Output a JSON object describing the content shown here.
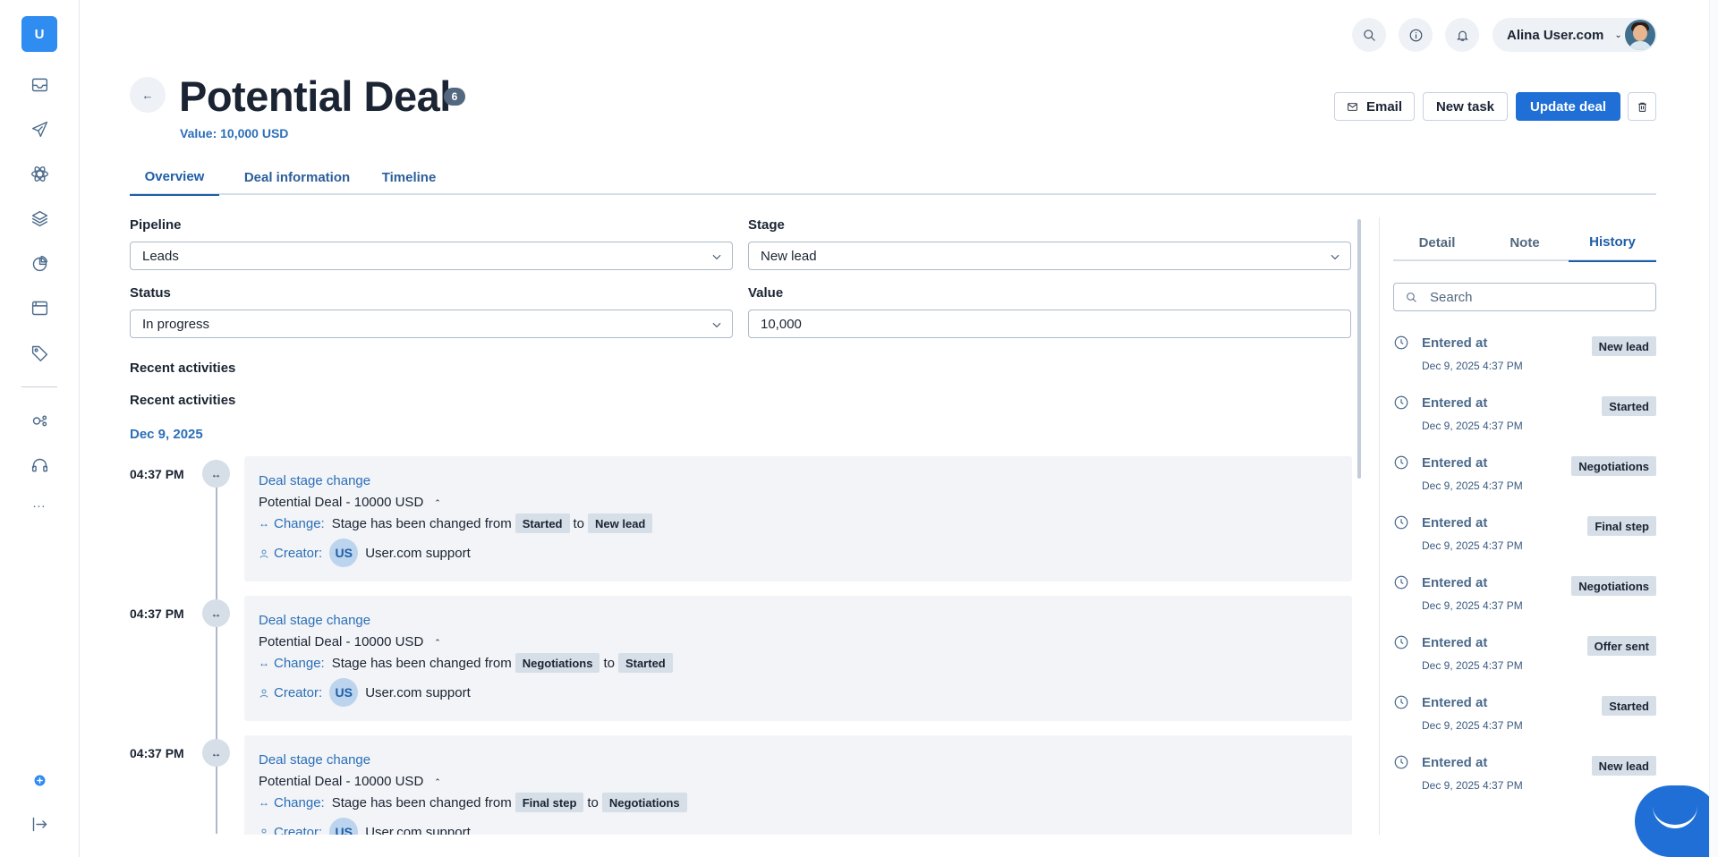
{
  "rail": {
    "logo": "U",
    "icons": [
      "inbox-icon",
      "send-icon",
      "atom-icon",
      "layers-icon",
      "segments-icon",
      "browser-icon",
      "tags-icon",
      "integration-icon",
      "support-icon"
    ],
    "more": "...",
    "bottom_icons": [
      "help-dot-icon",
      "logout-icon"
    ]
  },
  "topbar": {
    "user_name": "Alina User.com",
    "icons": [
      "search-icon",
      "info-icon",
      "bell-icon"
    ]
  },
  "header": {
    "back": "←",
    "title": "Potential Deal",
    "badge": "6",
    "value": "Value: 10,000 USD",
    "email_btn": "Email",
    "new_task_btn": "New task",
    "update_btn": "Update deal"
  },
  "tabs": [
    "Overview",
    "Deal information",
    "Timeline"
  ],
  "form": {
    "pipeline_label": "Pipeline",
    "pipeline_value": "Leads",
    "stage_label": "Stage",
    "stage_value": "New lead",
    "status_label": "Status",
    "status_value": "In progress",
    "value_label": "Value",
    "value_value": "10,000"
  },
  "activities": {
    "title1": "Recent activities",
    "title2": "Recent activities",
    "date": "Dec 9, 2025",
    "items": [
      {
        "time": "04:37 PM",
        "icon": "↔",
        "title": "Deal stage change",
        "deal": "Potential Deal - 10000 USD",
        "change_label": "Change:",
        "change_text": "Stage has been changed from",
        "from": "Started",
        "to_word": "to",
        "to": "New lead",
        "creator_label": "Creator:",
        "creator_initials": "US",
        "creator": "User.com support"
      },
      {
        "time": "04:37 PM",
        "icon": "↔",
        "title": "Deal stage change",
        "deal": "Potential Deal - 10000 USD",
        "change_label": "Change:",
        "change_text": "Stage has been changed from",
        "from": "Negotiations",
        "to_word": "to",
        "to": "Started",
        "creator_label": "Creator:",
        "creator_initials": "US",
        "creator": "User.com support"
      },
      {
        "time": "04:37 PM",
        "icon": "↔",
        "title": "Deal stage change",
        "deal": "Potential Deal - 10000 USD",
        "change_label": "Change:",
        "change_text": "Stage has been changed from",
        "from": "Final step",
        "to_word": "to",
        "to": "Negotiations",
        "creator_label": "Creator:",
        "creator_initials": "US",
        "creator": "User.com support"
      }
    ]
  },
  "side": {
    "tabs": [
      "Detail",
      "Note",
      "History"
    ],
    "active_tab": "History",
    "search_placeholder": "Search",
    "history": [
      {
        "label": "Entered at",
        "date": "Dec 9, 2025 4:37 PM",
        "tag": "New lead"
      },
      {
        "label": "Entered at",
        "date": "Dec 9, 2025 4:37 PM",
        "tag": "Started"
      },
      {
        "label": "Entered at",
        "date": "Dec 9, 2025 4:37 PM",
        "tag": "Negotiations"
      },
      {
        "label": "Entered at",
        "date": "Dec 9, 2025 4:37 PM",
        "tag": "Final step"
      },
      {
        "label": "Entered at",
        "date": "Dec 9, 2025 4:37 PM",
        "tag": "Negotiations"
      },
      {
        "label": "Entered at",
        "date": "Dec 9, 2025 4:37 PM",
        "tag": "Offer sent"
      },
      {
        "label": "Entered at",
        "date": "Dec 9, 2025 4:37 PM",
        "tag": "Started"
      },
      {
        "label": "Entered at",
        "date": "Dec 9, 2025 4:37 PM",
        "tag": "New lead"
      }
    ]
  },
  "colors": {
    "accent": "#1f6fd6",
    "link": "#2c6fb8",
    "tag_bg": "#d6dee8"
  }
}
